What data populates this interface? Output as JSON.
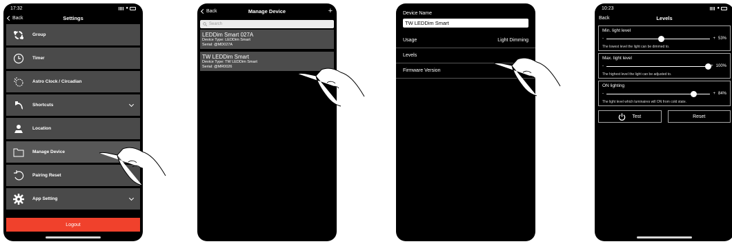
{
  "screen1": {
    "time": "17:32",
    "back_label": "Back",
    "title": "Settings",
    "items": [
      {
        "label": "Group",
        "icon": "group-icon"
      },
      {
        "label": "Timer",
        "icon": "clock-icon"
      },
      {
        "label": "Astro Clock / Circadian",
        "icon": "sun-moon-icon"
      },
      {
        "label": "Shortcuts",
        "icon": "shortcut-icon"
      },
      {
        "label": "Location",
        "icon": "location-icon"
      },
      {
        "label": "Manage Device",
        "icon": "folder-icon"
      },
      {
        "label": "Pairing Reset",
        "icon": "reset-icon"
      },
      {
        "label": "App Setting",
        "icon": "gear-icon"
      }
    ],
    "logout_label": "Logout",
    "accent": "#f0412c"
  },
  "screen2": {
    "back_label": "Back",
    "title": "Manage Device",
    "add_label": "+",
    "search_placeholder": "Search",
    "devices": [
      {
        "name": "LEDDim Smart 027A",
        "type": "Device Type: LEDDim Smart",
        "serial": "Serial: @MD027A"
      },
      {
        "name": "TW LEDDim Smart",
        "type": "Device Type: TW LEDDim Smart",
        "serial": "Serial: @MR0026"
      }
    ]
  },
  "screen3": {
    "device_name_label": "Device Name",
    "device_name_value": "TW LEDDim Smart",
    "usage_label": "Usage",
    "usage_value": "Light Dimming",
    "levels_label": "Levels",
    "firmware_label": "Firmware Version"
  },
  "screen4": {
    "time": "10:23",
    "back_label": "Back",
    "title": "Levels",
    "sliders": [
      {
        "title": "Min. light level",
        "minus": "-",
        "plus": "+",
        "value": "53%",
        "level": 0.53,
        "desc": "The lowest level the light can be dimmed to."
      },
      {
        "title": "Max. light level",
        "minus": "-",
        "plus": "+",
        "value": "100%",
        "level": 1.0,
        "desc": "The highest level the light can be adjusted to."
      },
      {
        "title": "ON lighting",
        "minus": "-",
        "plus": "+",
        "value": "84%",
        "level": 0.84,
        "desc": "The light level which luminaires will ON from cold state."
      }
    ],
    "test_label": "Test",
    "reset_label": "Reset"
  }
}
